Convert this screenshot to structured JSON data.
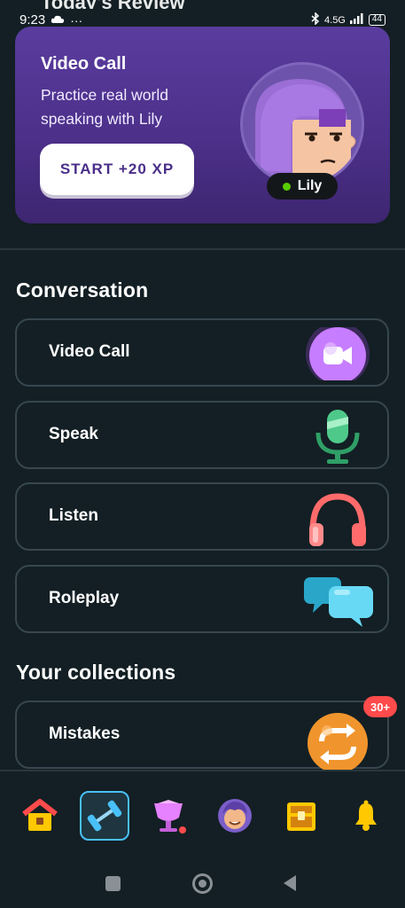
{
  "status_bar": {
    "time": "9:23",
    "network": "4.5G",
    "battery": "44"
  },
  "header": {
    "title": "Today's Review"
  },
  "hero": {
    "title": "Video Call",
    "subtitle": "Practice real world speaking with Lily",
    "button_label": "START +20 XP",
    "character_name": "Lily"
  },
  "conversation": {
    "title": "Conversation",
    "items": [
      {
        "label": "Video Call",
        "icon": "video-camera-icon"
      },
      {
        "label": "Speak",
        "icon": "microphone-icon"
      },
      {
        "label": "Listen",
        "icon": "headphones-icon"
      },
      {
        "label": "Roleplay",
        "icon": "chat-bubbles-icon"
      }
    ]
  },
  "collections": {
    "title": "Your collections",
    "items": [
      {
        "label": "Mistakes",
        "badge": "30+",
        "icon": "repeat-icon"
      }
    ]
  },
  "bottom_nav": {
    "items": [
      {
        "name": "home",
        "icon": "house-icon"
      },
      {
        "name": "practice",
        "icon": "dumbbell-icon",
        "active": true
      },
      {
        "name": "leagues",
        "icon": "trophy-icon"
      },
      {
        "name": "characters",
        "icon": "character-face-icon"
      },
      {
        "name": "quests",
        "icon": "treasure-chest-icon"
      },
      {
        "name": "notifications",
        "icon": "bell-icon"
      }
    ]
  },
  "colors": {
    "background": "#131f24",
    "hero_purple": "#4b2f88",
    "border": "#37464f",
    "accent_blue": "#49c0f8",
    "badge_red": "#ff4b4b",
    "online_green": "#58cc02"
  }
}
